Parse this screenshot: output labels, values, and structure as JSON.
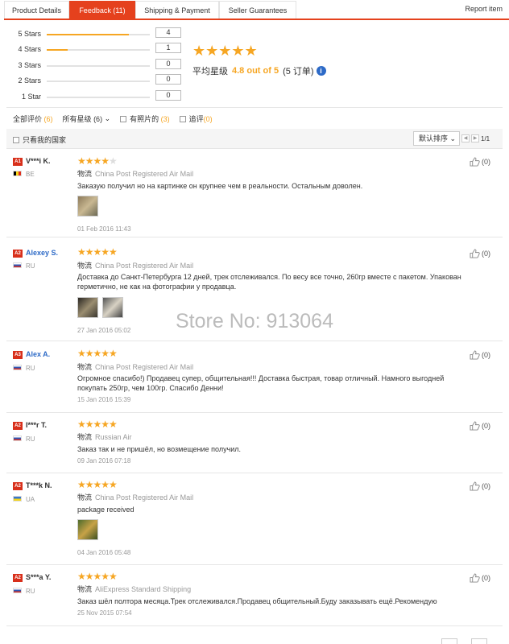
{
  "tabs": [
    {
      "label": "Product Details",
      "active": false
    },
    {
      "label": "Feedback (11)",
      "active": true
    },
    {
      "label": "Shipping & Payment",
      "active": false
    },
    {
      "label": "Seller Guarantees",
      "active": false
    }
  ],
  "report_label": "Report item",
  "histogram": [
    {
      "label": "5 Stars",
      "count": "4",
      "fill_fraction": 0.8
    },
    {
      "label": "4 Stars",
      "count": "1",
      "fill_fraction": 0.2
    },
    {
      "label": "3 Stars",
      "count": "0",
      "fill_fraction": 0
    },
    {
      "label": "2 Stars",
      "count": "0",
      "fill_fraction": 0
    },
    {
      "label": "1 Star",
      "count": "0",
      "fill_fraction": 0
    }
  ],
  "rating": {
    "stars": "★★★★★",
    "avg_label": "平均星级",
    "avg_value": "4.8 out of 5",
    "orders": "(5 订单)",
    "info_icon": "i"
  },
  "filters": {
    "all": "全部评价",
    "all_count": "(6)",
    "all_stars": "所有星级",
    "all_stars_count": "(6)",
    "dropdown": "⌄",
    "with_photos": "有照片的",
    "with_photos_count": "(3)",
    "additional": "追评",
    "additional_count": "(0)"
  },
  "toolbar": {
    "country_only": "只看我的国家",
    "sort_label": "默认排序",
    "sort_chevron": "⌄",
    "prev": "◀",
    "next": "▶",
    "page": "1/1"
  },
  "ship_label": "物流",
  "reviews": [
    {
      "level": "A1",
      "name": "V***i K.",
      "country": "BE",
      "stars": "★★★★",
      "stars_off": "★",
      "shipping": "China Post Registered Air Mail",
      "text": "Заказую получил но на картинке он крупнее чем в реальности. Остальным доволен.",
      "date": "01 Feb 2016 11:43",
      "likes": "(0)",
      "link": false
    },
    {
      "level": "A2",
      "name": "Alexey S.",
      "country": "RU",
      "stars": "★★★★★",
      "stars_off": "",
      "shipping": "China Post Registered Air Mail",
      "text": "Доставка до Санкт-Петербурга 12 дней, трек отслеживался. По весу все точно, 260гр вместе с пакетом. Упакован герметично, не как на фотографии у продавца.",
      "date": "27 Jan 2016 05:02",
      "likes": "(0)",
      "link": true
    },
    {
      "level": "A3",
      "name": "Alex A.",
      "country": "RU",
      "stars": "★★★★★",
      "stars_off": "",
      "shipping": "China Post Registered Air Mail",
      "text": "Огромное спасибо!) Продавец супер, общительная!!! Доставка быстрая, товар отличный. Намного выгодней покупать 250гр, чем 100гр. Спасибо Денни!",
      "date": "15 Jan 2016 15:39",
      "likes": "(0)",
      "link": true
    },
    {
      "level": "A2",
      "name": "I***r T.",
      "country": "RU",
      "stars": "★★★★★",
      "stars_off": "",
      "shipping": "Russian Air",
      "text": "Заказ так и не пришёл, но возмещение получил.",
      "date": "09 Jan 2016 07:18",
      "likes": "(0)",
      "link": false
    },
    {
      "level": "A2",
      "name": "T***k N.",
      "country": "UA",
      "stars": "★★★★★",
      "stars_off": "",
      "shipping": "China Post Registered Air Mail",
      "text": "package received",
      "date": "04 Jan 2016 05:48",
      "likes": "(0)",
      "link": false
    },
    {
      "level": "A2",
      "name": "S***a Y.",
      "country": "RU",
      "stars": "★★★★★",
      "stars_off": "",
      "shipping": "AliExpress Standard Shipping",
      "text": "Заказ шёл полтора месяца.Трек отслеживался.Продавец общительный.Буду заказывать ещё.Рекомендую",
      "date": "25 Nov 2015 07:54",
      "likes": "(0)",
      "link": false
    }
  ],
  "watermark": "Store No: 913064",
  "colors": {
    "accent": "#e5411d",
    "star": "#f6a623",
    "link": "#2d6ac7"
  }
}
